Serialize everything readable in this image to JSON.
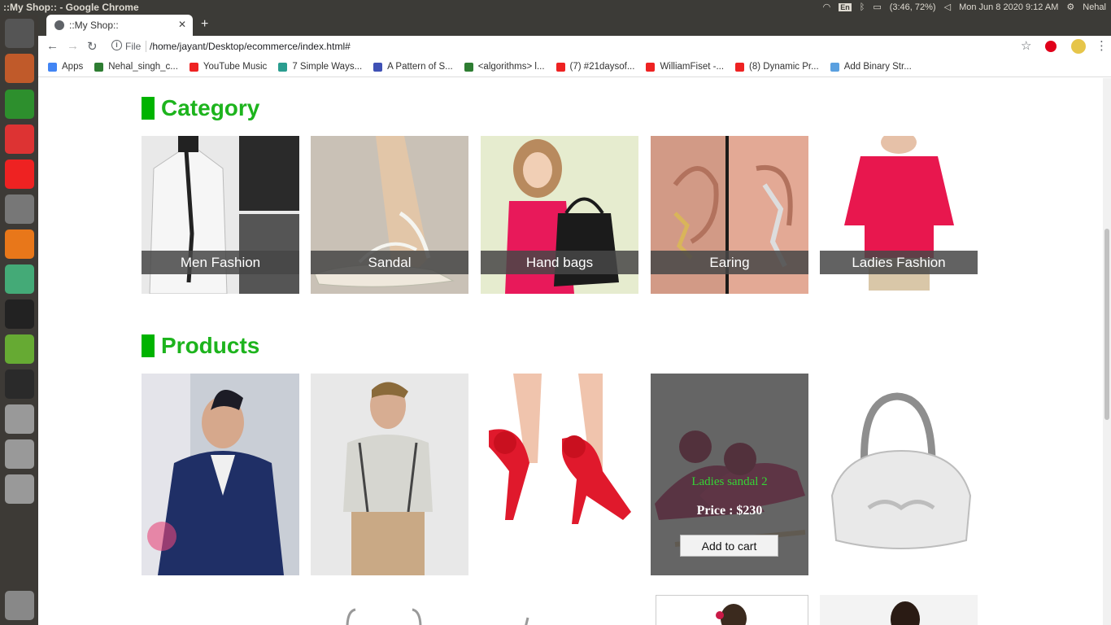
{
  "os": {
    "window_title": "::My Shop:: - Google Chrome",
    "keyboard": "En",
    "battery": "(3:46, 72%)",
    "clock": "Mon Jun  8 2020  9:12 AM",
    "user": "Nehal"
  },
  "launcher": {
    "items": [
      {
        "name": "dash-icon",
        "color": "#555"
      },
      {
        "name": "files-icon",
        "color": "#c05a2a"
      },
      {
        "name": "chrome-icon",
        "color": "#2d8f2d"
      },
      {
        "name": "editor-icon",
        "color": "#d33"
      },
      {
        "name": "youtube-music-icon",
        "color": "#e22"
      },
      {
        "name": "text-editor-icon",
        "color": "#777"
      },
      {
        "name": "sublime-icon",
        "color": "#e8771a"
      },
      {
        "name": "cube-app-icon",
        "color": "#4a7"
      },
      {
        "name": "intellij-icon",
        "color": "#222"
      },
      {
        "name": "starred-app-icon",
        "color": "#6a3"
      },
      {
        "name": "terminal-icon",
        "color": "#2a2a2a"
      },
      {
        "name": "drive-1-icon",
        "color": "#999"
      },
      {
        "name": "drive-2-icon",
        "color": "#999"
      },
      {
        "name": "drive-3-icon",
        "color": "#999"
      },
      {
        "name": "trash-icon",
        "color": "#888"
      }
    ]
  },
  "browser": {
    "tab_title": "::My Shop::",
    "url_scheme": "File",
    "url": "/home/jayant/Desktop/ecommerce/index.html#",
    "bookmarks": [
      {
        "label": "Apps",
        "color": "#4285f4"
      },
      {
        "label": "Nehal_singh_c...",
        "color": "#2e7d32"
      },
      {
        "label": "YouTube Music",
        "color": "#e22"
      },
      {
        "label": "7 Simple Ways...",
        "color": "#2a9d8f"
      },
      {
        "label": "A Pattern of S...",
        "color": "#3f51b5"
      },
      {
        "label": "<algorithms> l...",
        "color": "#2e7d32"
      },
      {
        "label": "(7) #21daysof...",
        "color": "#e22"
      },
      {
        "label": "WilliamFiset -...",
        "color": "#e22"
      },
      {
        "label": "(8) Dynamic Pr...",
        "color": "#e22"
      },
      {
        "label": "Add Binary Str...",
        "color": "#5aa0e0"
      }
    ]
  },
  "page": {
    "category_heading": "Category",
    "products_heading": "Products",
    "categories": [
      {
        "label": "Men Fashion"
      },
      {
        "label": "Sandal"
      },
      {
        "label": "Hand bags"
      },
      {
        "label": "Earing"
      },
      {
        "label": "Ladies Fashion"
      }
    ],
    "hovered_product": {
      "name": "Ladies sandal 2",
      "price": "Price : $230",
      "button": "Add to cart"
    }
  }
}
